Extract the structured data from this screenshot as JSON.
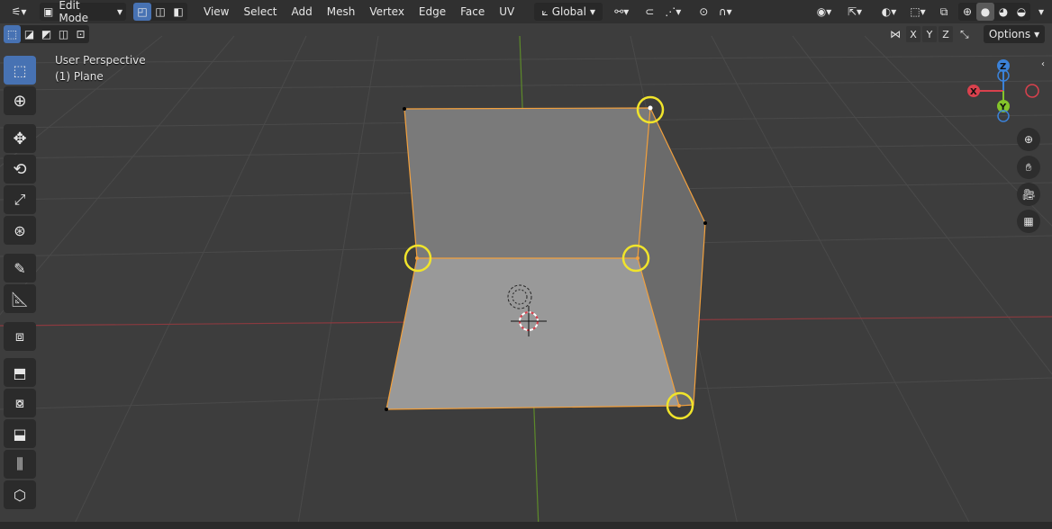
{
  "header": {
    "mode": "Edit Mode",
    "menus": [
      "View",
      "Select",
      "Add",
      "Mesh",
      "Vertex",
      "Edge",
      "Face",
      "UV"
    ],
    "orientation": "Global",
    "options_label": "Options",
    "axis_buttons": [
      "X",
      "Y",
      "Z"
    ]
  },
  "overlay": {
    "view_name": "User Perspective",
    "object_name": "(1) Plane"
  },
  "gizmo": {
    "x": "X",
    "y": "Y",
    "z": "Z"
  },
  "tools": [
    "select-box",
    "cursor",
    "move",
    "rotate",
    "scale",
    "transform",
    "annotate",
    "measure",
    "add-cube",
    "extrude",
    "inset",
    "bevel",
    "loop-cut",
    "knife"
  ],
  "colors": {
    "accent": "#4772b3",
    "selection": "#f2a03d",
    "highlight": "#f0e42b",
    "x_axis": "#d9414d",
    "y_axis": "#84c42a",
    "z_axis": "#3b82d9"
  }
}
